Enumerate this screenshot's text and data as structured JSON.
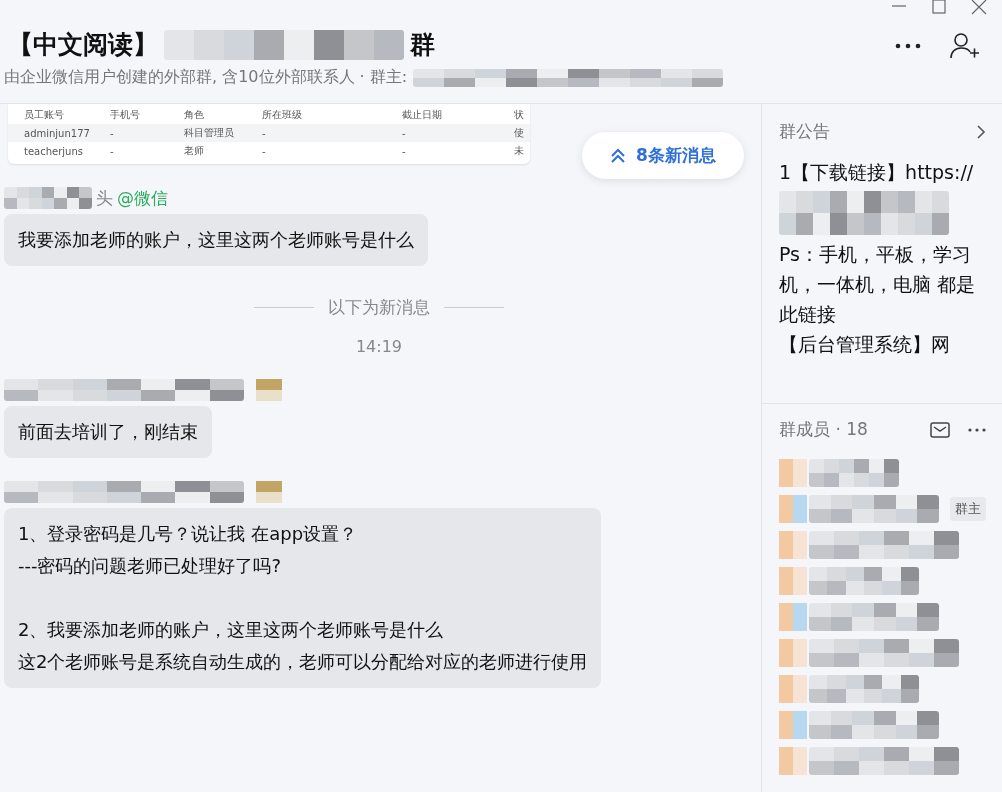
{
  "header": {
    "title_start": "【中文阅读】",
    "title_end": "群",
    "subtitle": "由企业微信用户创建的外部群, 含10位外部联系人 · 群主:"
  },
  "messages": [
    {
      "kind": "table_image",
      "columns": [
        "员工账号",
        "手机号",
        "角色",
        "所在班级",
        "截止日期",
        "状"
      ],
      "rows": [
        [
          "adminjun177",
          "-",
          "科目管理员",
          "-",
          "-",
          "使"
        ],
        [
          "teacherjuns",
          "-",
          "老师",
          "-",
          "-",
          "未"
        ]
      ]
    },
    {
      "kind": "sender",
      "name_tail": "头",
      "tag": "@微信"
    },
    {
      "kind": "bubble",
      "text": "我要添加老师的账户，这里这两个老师账号是什么"
    },
    {
      "kind": "divider",
      "text": "以下为新消息"
    },
    {
      "kind": "time",
      "text": "14:19"
    },
    {
      "kind": "sender"
    },
    {
      "kind": "bubble",
      "text": "前面去培训了，刚结束"
    },
    {
      "kind": "sender"
    },
    {
      "kind": "bubble",
      "paragraphs": [
        [
          "1、登录密码是几号？说让我 在app设置？",
          "---密码的问题老师已处理好了吗?"
        ],
        [
          "2、我要添加老师的账户，这里这两个老师账号是什么",
          "这2个老师账号是系统自动生成的，老师可以分配给对应的老师进行使用"
        ]
      ]
    }
  ],
  "new_messages": {
    "label": "8条新消息"
  },
  "announcement": {
    "title": "群公告",
    "lines": [
      "1【下载链接】https://",
      "Ps：手机，平板，学习机，一体机，电脑 都是此链接",
      "【后台管理系统】网"
    ]
  },
  "members": {
    "title": "群成员 · 18",
    "items": [
      {
        "owner": false
      },
      {
        "owner": true
      },
      {
        "owner": false
      },
      {
        "owner": false
      },
      {
        "owner": false
      },
      {
        "owner": false
      },
      {
        "owner": false
      },
      {
        "owner": false
      },
      {
        "owner": false
      }
    ],
    "owner_badge": "群主"
  }
}
